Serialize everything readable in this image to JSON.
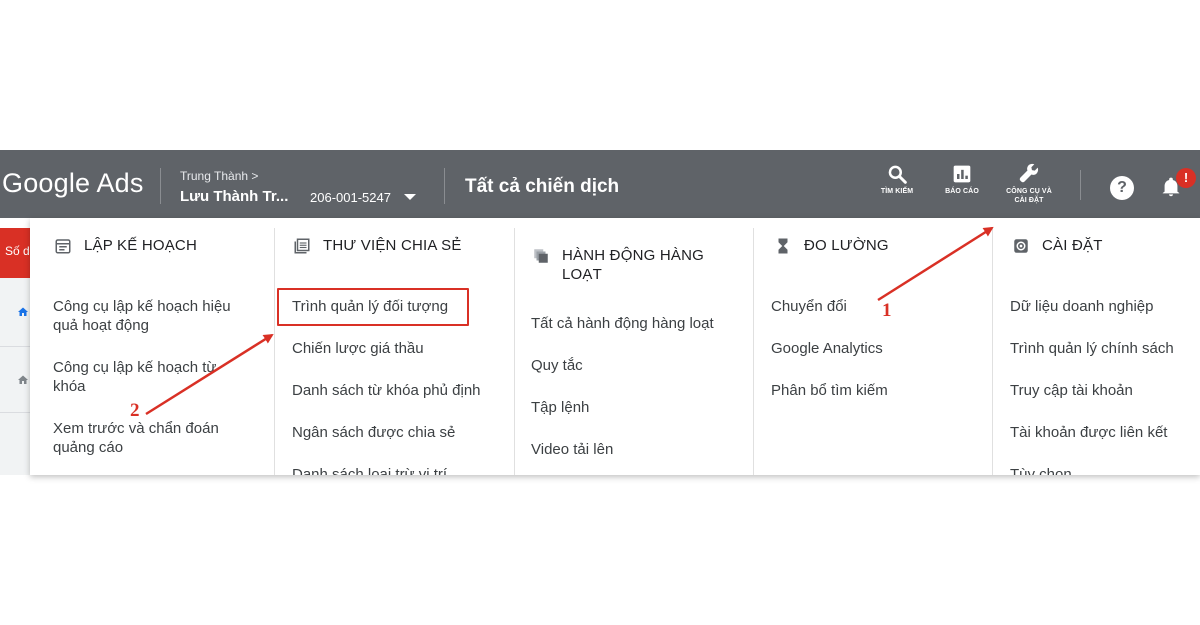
{
  "topbar": {
    "logo": "Google Ads",
    "account_parent": "Trung Thành  >",
    "account_name": "Lưu Thành Tr...",
    "account_id": "206-001-5247",
    "campaign_title": "Tất cả chiến dịch",
    "search_label": "TÌM KIẾM",
    "reports_label": "BÁO CÁO",
    "tools_label_line1": "CÔNG CỤ VÀ",
    "tools_label_line2": "CÀI ĐẶT",
    "help_symbol": "?",
    "notification_symbol": "!"
  },
  "leftstrip": {
    "red_label": "Số d"
  },
  "menu": {
    "columns": [
      {
        "icon": "calendar-icon",
        "title": "LẬP KẾ HOẠCH",
        "items": [
          "Công cụ lập kế hoạch hiệu",
          "quả hoạt động",
          "Công cụ lập kế hoạch từ",
          "khóa",
          "Xem trước và chẩn đoán",
          "quảng cáo"
        ]
      },
      {
        "icon": "library-icon",
        "title": "THƯ VIỆN CHIA SẺ",
        "items": [
          "Trình quản lý đối tượng",
          "Chiến lược giá thầu",
          "Danh sách từ khóa phủ định",
          "Ngân sách được chia sẻ",
          "Danh sách loại trừ vị trí"
        ]
      },
      {
        "icon": "bulk-actions-icon",
        "title_line1": "HÀNH ĐỘNG HÀNG",
        "title_line2": "LOẠT",
        "items": [
          "Tất cả hành động hàng loạt",
          "Quy tắc",
          "Tập lệnh",
          "Video tải lên"
        ]
      },
      {
        "icon": "hourglass-icon",
        "title": "ĐO LƯỜNG",
        "items": [
          "Chuyển đổi",
          "Google Analytics",
          "Phân bổ tìm kiếm"
        ]
      },
      {
        "icon": "settings-icon",
        "title": "CÀI ĐẶT",
        "items": [
          "Dữ liệu doanh nghiệp",
          "Trình quản lý chính sách",
          "Truy cập tài khoản",
          "Tài khoản được liên kết",
          "Tùy chọn"
        ]
      }
    ]
  },
  "annotations": {
    "step1": "1",
    "step2": "2",
    "color": "#d93025"
  },
  "colors": {
    "topbar_bg": "#5f6368",
    "accent_red": "#d93025"
  }
}
